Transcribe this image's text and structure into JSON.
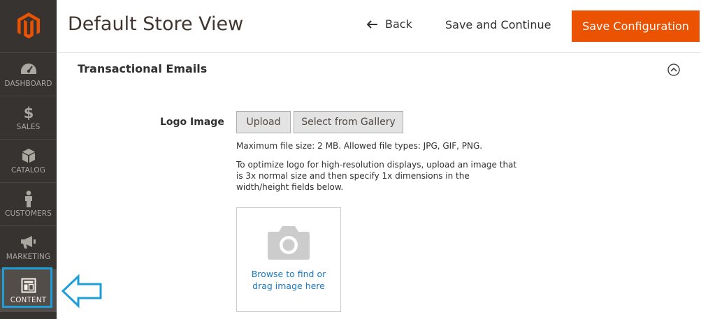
{
  "sidebar": {
    "items": [
      {
        "label": "DASHBOARD",
        "icon": "dashboard-icon"
      },
      {
        "label": "SALES",
        "icon": "dollar-icon"
      },
      {
        "label": "CATALOG",
        "icon": "box-icon"
      },
      {
        "label": "CUSTOMERS",
        "icon": "person-icon"
      },
      {
        "label": "MARKETING",
        "icon": "megaphone-icon"
      },
      {
        "label": "CONTENT",
        "icon": "layout-icon",
        "active": true
      }
    ]
  },
  "header": {
    "title": "Default Store View",
    "back_label": "Back",
    "save_continue_label": "Save and Continue",
    "save_config_label": "Save Configuration"
  },
  "section": {
    "title": "Transactional Emails",
    "field_label": "Logo Image",
    "upload_label": "Upload",
    "gallery_label": "Select from Gallery",
    "note_filesize": "Maximum file size: 2 MB. Allowed file types: JPG, GIF, PNG.",
    "note_hires": "To optimize logo for high-resolution displays, upload an image that is 3x normal size and then specify 1x dimensions in the width/height fields below.",
    "dropzone_text": "Browse to find or drag image here"
  },
  "colors": {
    "sidebar_bg": "#373330",
    "accent": "#eb5202",
    "link": "#1979c3",
    "highlight": "#1e9ed9"
  }
}
